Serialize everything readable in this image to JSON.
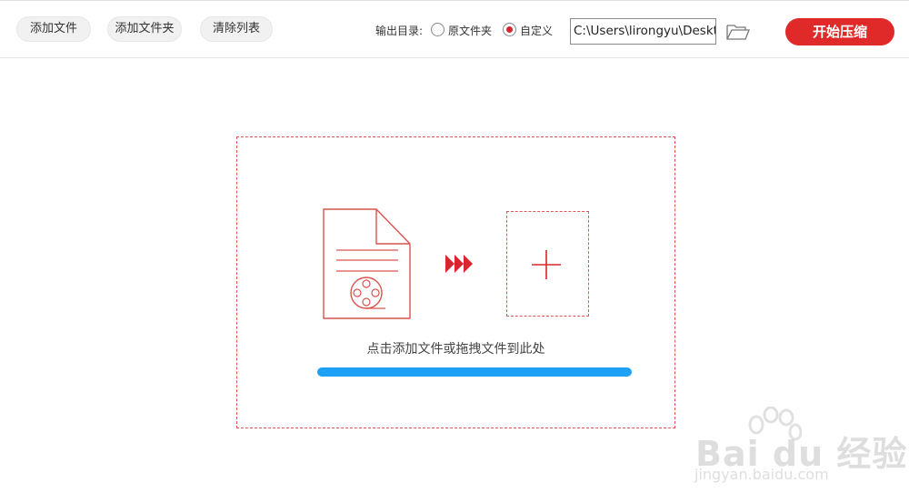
{
  "toolbar": {
    "add_file_label": "添加文件",
    "add_folder_label": "添加文件夹",
    "clear_list_label": "清除列表",
    "output_dir_label": "输出目录:",
    "radio_original_label": "原文件夹",
    "radio_custom_label": "自定义",
    "selected_output": "custom",
    "output_path": "C:\\Users\\lirongyu\\Desktop",
    "start_label": "开始压缩"
  },
  "dropzone": {
    "hint_text": "点击添加文件或拖拽文件到此处",
    "progress": 1.0,
    "icons": [
      "document-video-icon",
      "fast-forward-icon",
      "plus-icon"
    ]
  },
  "watermark": {
    "brand": "Bai du 经验",
    "url": "jingyan.baidu.com"
  },
  "colors": {
    "accent": "#e02a2a",
    "progress": "#1ea0f5",
    "dash": "#e05555"
  }
}
